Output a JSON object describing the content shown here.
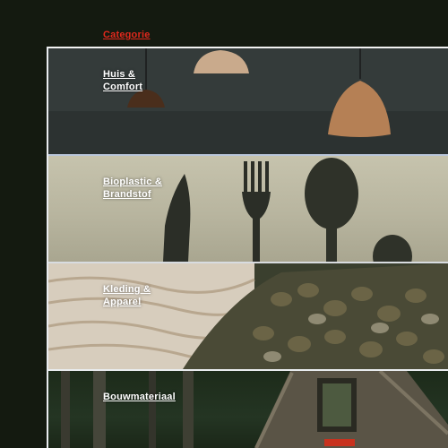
{
  "header": {
    "title": "Categorie"
  },
  "categories": [
    {
      "line1": "Huis &",
      "line2": "Comfort"
    },
    {
      "line1": "Bioplastic &",
      "line2": "Brandstof"
    },
    {
      "line1": "Kleding &",
      "line2": "Apparel"
    },
    {
      "line1": "Bouwmateriaal",
      "line2": ""
    }
  ],
  "colors": {
    "accent": "#e0281c",
    "background": "#141a10",
    "divider": "#e9ecef"
  }
}
